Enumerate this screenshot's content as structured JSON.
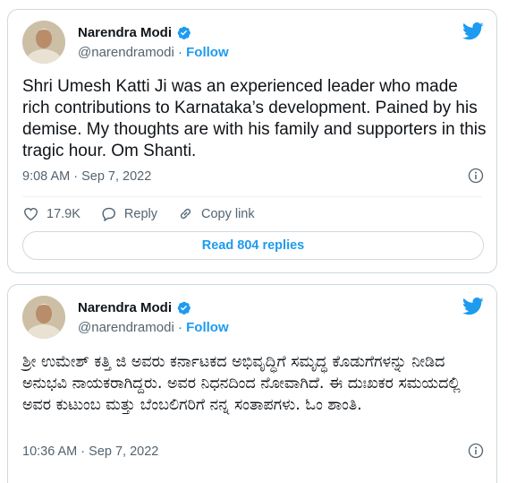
{
  "tweets": [
    {
      "author": {
        "name": "Narendra Modi",
        "handle": "@narendramodi",
        "follow_label": "Follow"
      },
      "text": "Shri Umesh Katti Ji was an experienced leader who made rich contributions to Karnataka’s development. Pained by his demise. My thoughts are with his family and supporters in this tragic hour. Om Shanti.",
      "timestamp": "9:08 AM · Sep 7, 2022",
      "likes": "17.9K",
      "reply_label": "Reply",
      "copy_link_label": "Copy link",
      "read_replies_label": "Read 804 replies"
    },
    {
      "author": {
        "name": "Narendra Modi",
        "handle": "@narendramodi",
        "follow_label": "Follow"
      },
      "text": "ಶ್ರೀ ಉಮೇಶ್ ಕತ್ತಿ ಜಿ ಅವರು ಕರ್ನಾಟಕದ ಅಭಿವೃದ್ಧಿಗೆ ಸಮೃದ್ಧ ಕೊಡುಗೆಗಳನ್ನು ನೀಡಿದ ಅನುಭವಿ ನಾಯಕರಾಗಿದ್ದರು. ಅವರ ನಿಧನದಿಂದ ನೋವಾಗಿದೆ. ಈ ದುಃಖಕರ ಸಮಯದಲ್ಲಿ ಅವರ ಕುಟುಂಬ ಮತ್ತು ಬೆಂಬಲಿಗರಿಗೆ ನನ್ನ ಸಂತಾಪಗಳು. ಓಂ ಶಾಂತಿ.",
      "timestamp": "10:36 AM · Sep 7, 2022"
    }
  ],
  "colors": {
    "accent": "#1d9bf0",
    "secondary_text": "#536471",
    "border": "#cfd9de"
  },
  "icons": [
    "verified-badge-icon",
    "twitter-bird-icon",
    "info-icon",
    "heart-icon",
    "reply-icon",
    "link-icon"
  ]
}
